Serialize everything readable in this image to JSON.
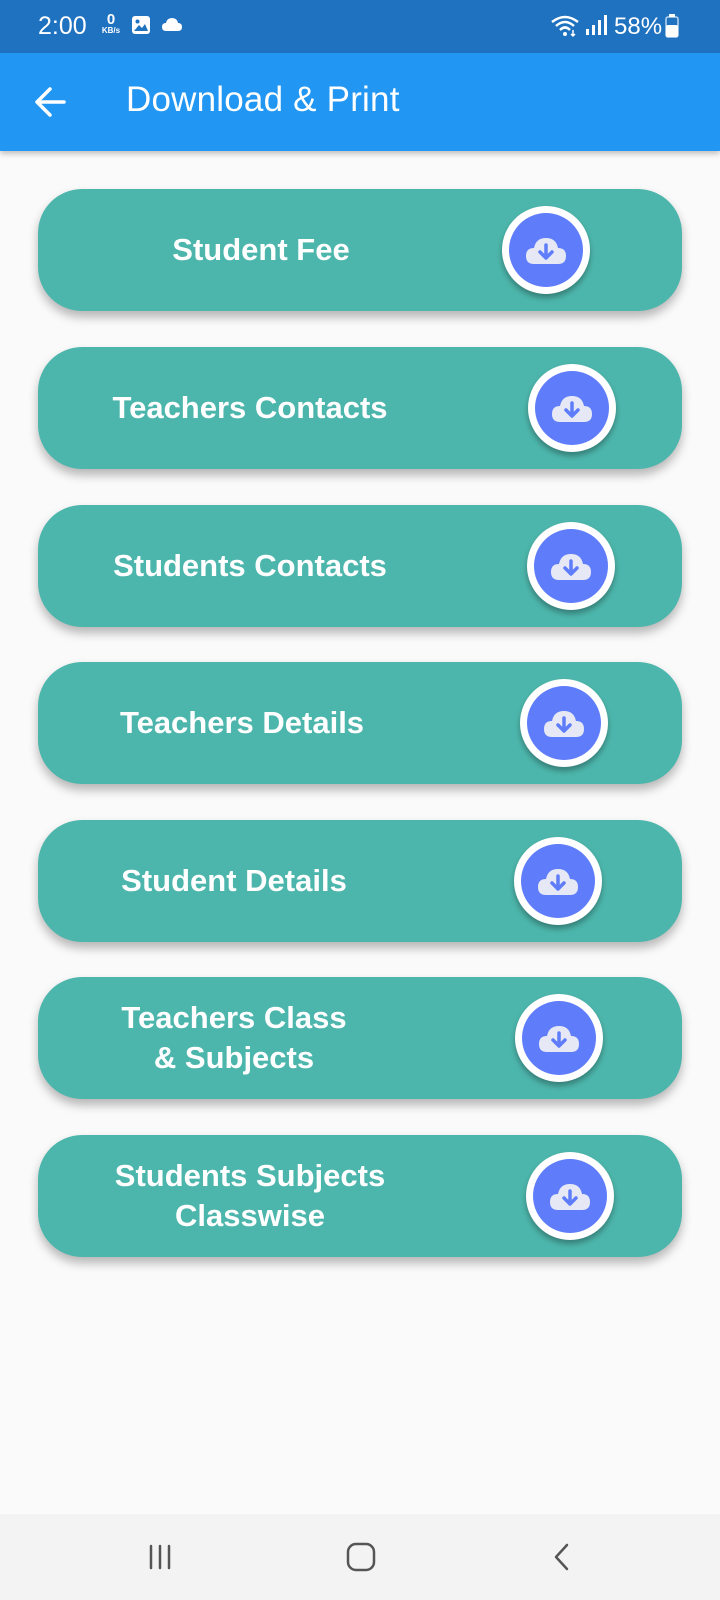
{
  "status_bar": {
    "time": "2:00",
    "net_speed_value": "0",
    "net_speed_unit": "KB/s",
    "battery": "58%"
  },
  "app_bar": {
    "title": "Download & Print"
  },
  "cards": [
    {
      "label": "Student Fee"
    },
    {
      "label": "Teachers Contacts"
    },
    {
      "label": "Students Contacts"
    },
    {
      "label": "Teachers Details"
    },
    {
      "label": "Student Details"
    },
    {
      "label": "Teachers Class\n& Subjects"
    },
    {
      "label": "Students Subjects\nClasswise"
    }
  ],
  "colors": {
    "status_bar": "#1f72c0",
    "app_bar": "#2196f3",
    "card": "#4db6ac",
    "download_circle": "#5f7dfa"
  },
  "icons": [
    "back-arrow-icon",
    "gallery-icon",
    "cloud-icon",
    "wifi-icon",
    "signal-icon",
    "battery-icon",
    "cloud-download-icon",
    "recent-apps-icon",
    "home-icon",
    "back-icon"
  ]
}
